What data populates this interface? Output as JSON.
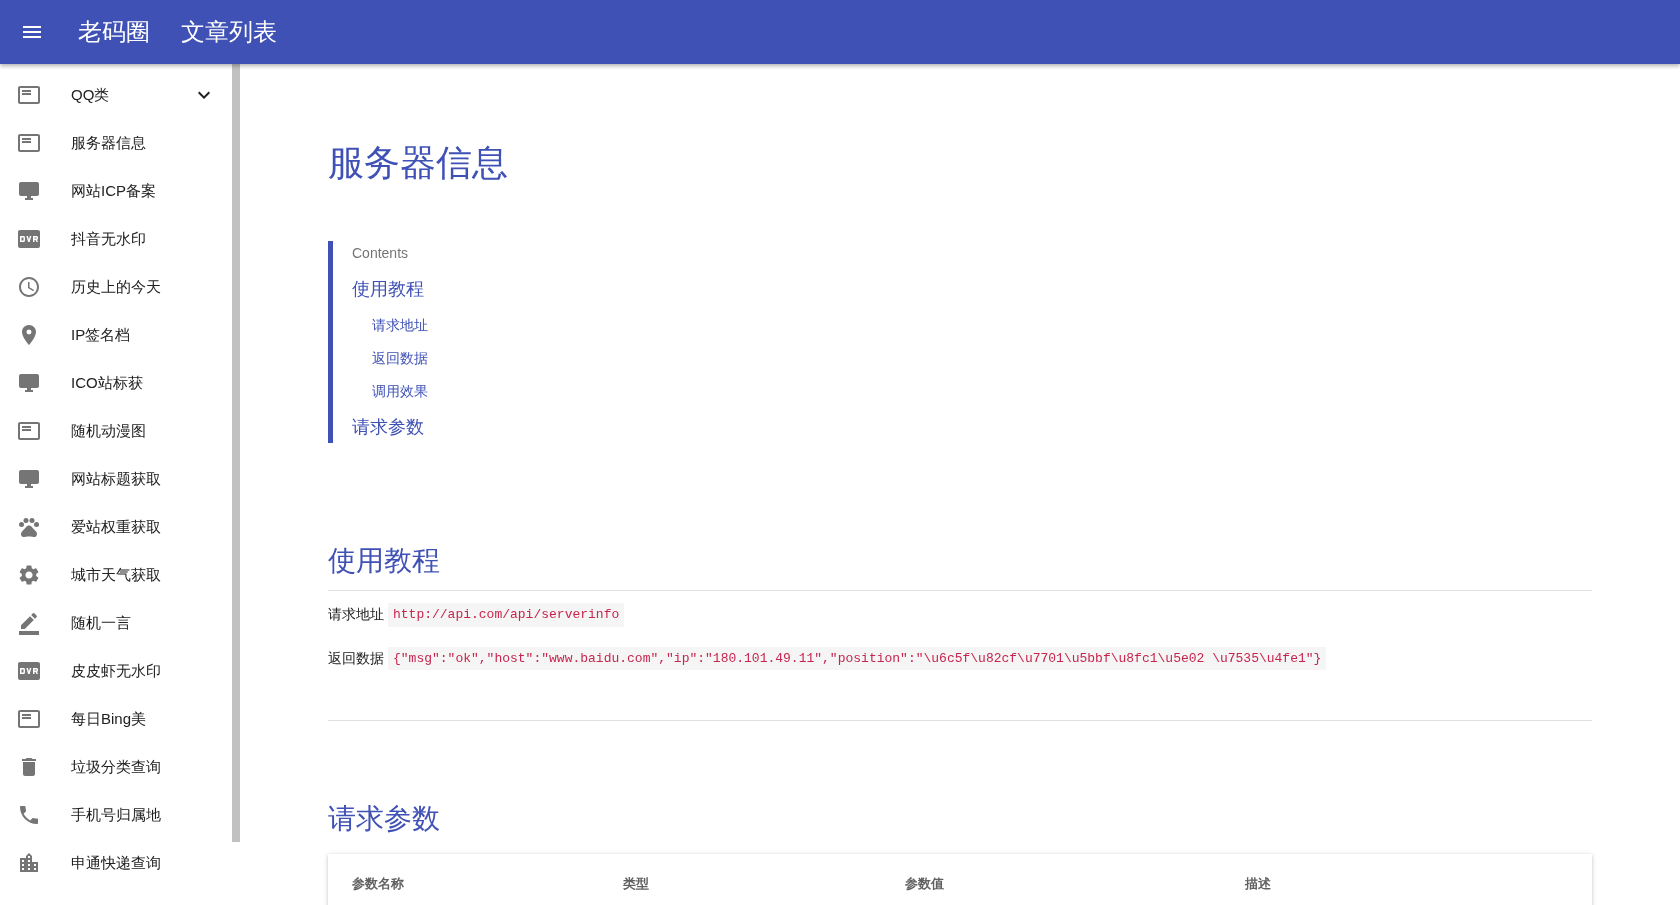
{
  "app_bar": {
    "brand": "老码圈",
    "title": "文章列表"
  },
  "sidebar": {
    "items": [
      {
        "label": "QQ类",
        "kind": "group",
        "expanded": false
      },
      {
        "label": "服务器信息",
        "kind": "link"
      },
      {
        "label": "网站ICP备案",
        "kind": "link"
      },
      {
        "label": "抖音无水印",
        "kind": "link"
      },
      {
        "label": "历史上的今天",
        "kind": "link"
      },
      {
        "label": "IP签名档",
        "kind": "link"
      },
      {
        "label": "ICO站标获",
        "kind": "link"
      },
      {
        "label": "随机动漫图",
        "kind": "link"
      },
      {
        "label": "网站标题获取",
        "kind": "link"
      },
      {
        "label": "爱站权重获取",
        "kind": "link"
      },
      {
        "label": "城市天气获取",
        "kind": "link"
      },
      {
        "label": "随机一言",
        "kind": "link"
      },
      {
        "label": "皮皮虾无水印",
        "kind": "link"
      },
      {
        "label": "每日Bing美",
        "kind": "link"
      },
      {
        "label": "垃圾分类查询",
        "kind": "link"
      },
      {
        "label": "手机号归属地",
        "kind": "link"
      },
      {
        "label": "申通快递查询",
        "kind": "link"
      }
    ]
  },
  "article": {
    "title": "服务器信息",
    "toc": {
      "heading": "Contents",
      "entries": [
        {
          "label": "使用教程",
          "children": [
            {
              "label": "请求地址"
            },
            {
              "label": "返回数据"
            },
            {
              "label": "调用效果"
            }
          ]
        },
        {
          "label": "请求参数"
        }
      ]
    },
    "sections": [
      {
        "heading": "使用教程",
        "lines": [
          {
            "label": "请求地址",
            "code": "http://api.com/api/serverinfo"
          },
          {
            "label": "返回数据",
            "code": "{\"msg\":\"ok\",\"host\":\"www.baidu.com\",\"ip\":\"180.101.49.11\",\"position\":\"\\u6c5f\\u82cf\\u7701\\u5bbf\\u8fc1\\u5e02 \\u7535\\u4fe1\"}"
          }
        ]
      },
      {
        "heading": "请求参数",
        "table": {
          "columns": [
            "参数名称",
            "类型",
            "参数值",
            "描述"
          ]
        }
      }
    ]
  }
}
